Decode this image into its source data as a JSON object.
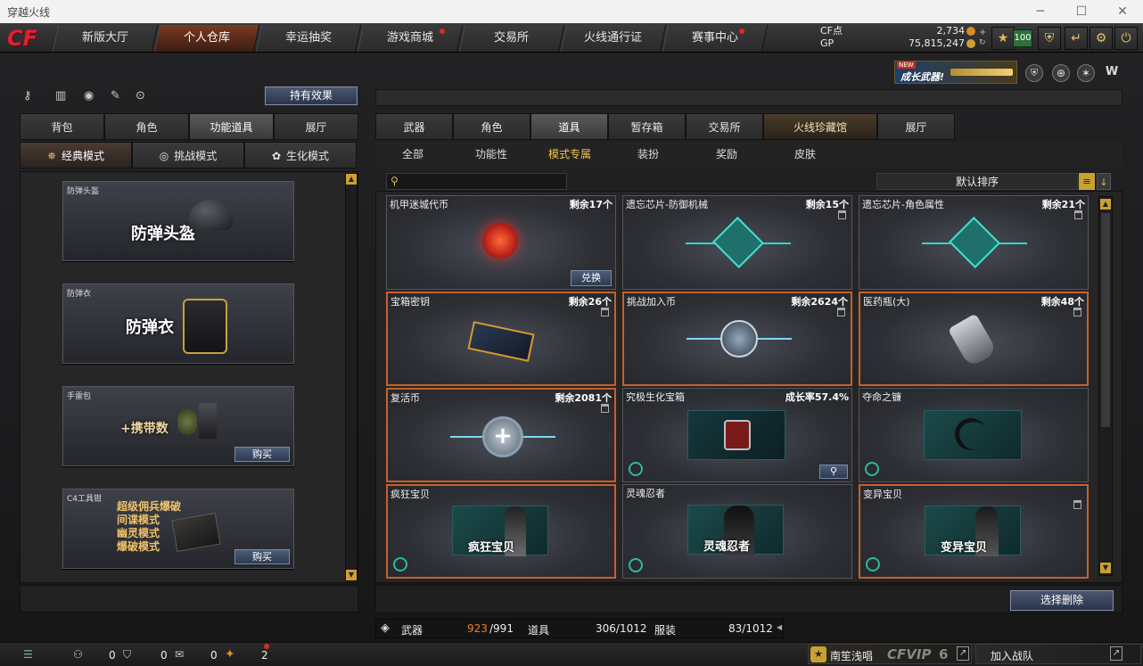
{
  "window": {
    "title": "穿越火线"
  },
  "nav": {
    "tabs": [
      {
        "label": "新版大厅"
      },
      {
        "label": "个人仓库"
      },
      {
        "label": "幸运抽奖"
      },
      {
        "label": "游戏商城"
      },
      {
        "label": "交易所"
      },
      {
        "label": "火线通行证"
      },
      {
        "label": "赛事中心"
      }
    ],
    "active": "个人仓库"
  },
  "currency": {
    "cf_label": "CF点",
    "cf_value": "2,734",
    "gp_label": "GP",
    "gp_value": "75,815,247"
  },
  "level_badge": "100",
  "banner": {
    "new_tag": "NEW",
    "text": "成长武器!"
  },
  "left": {
    "effect_button": "持有效果",
    "tabs": [
      "背包",
      "角色",
      "功能道具",
      "展厅"
    ],
    "modes": [
      "经典模式",
      "挑战模式",
      "生化模式"
    ],
    "cards": [
      {
        "caption": "防弹头盔",
        "title": "防弹头盔"
      },
      {
        "caption": "防弹衣",
        "title": "防弹衣"
      },
      {
        "caption": "手雷包",
        "title": "+携带数",
        "button": "购买"
      },
      {
        "caption": "C4工具钳",
        "lines": [
          "超级佣兵爆破",
          "间谍模式",
          "幽灵模式",
          "爆破模式"
        ],
        "button": "购买"
      }
    ]
  },
  "right": {
    "tabs": [
      "武器",
      "角色",
      "道具",
      "暂存箱",
      "交易所",
      "火线珍藏馆",
      "展厅"
    ],
    "subtabs": [
      "全部",
      "功能性",
      "模式专属",
      "装扮",
      "奖励",
      "皮肤"
    ],
    "active_subtab": "模式专属",
    "sort_label": "默认排序",
    "items": [
      {
        "name": "机甲迷城代币",
        "count": "剩余17个",
        "button": "兑换"
      },
      {
        "name": "遗忘芯片-防御机械",
        "count": "剩余15个"
      },
      {
        "name": "遗忘芯片-角色属性",
        "count": "剩余21个"
      },
      {
        "name": "宝箱密钥",
        "count": "剩余26个"
      },
      {
        "name": "挑战加入币",
        "count": "剩余2624个"
      },
      {
        "name": "医药瓶(大)",
        "count": "剩余48个"
      },
      {
        "name": "复活币",
        "count": "剩余2081个"
      },
      {
        "name": "究极生化宝箱",
        "count": "成长率57.4%"
      },
      {
        "name": "夺命之镰",
        "count": ""
      },
      {
        "name": "疯狂宝贝",
        "count": "",
        "tag": "疯狂宝贝"
      },
      {
        "name": "灵魂忍者",
        "count": "",
        "tag": "灵魂忍者"
      },
      {
        "name": "变异宝贝",
        "count": "",
        "tag": "变异宝贝"
      }
    ],
    "delete_button": "选择删除",
    "stats": {
      "weapon_label": "武器",
      "weapon_used": "923",
      "weapon_total": "/991",
      "item_label": "道具",
      "item_value": "306/1012",
      "outfit_label": "服装",
      "outfit_value": "83/1012"
    }
  },
  "footer": {
    "count1": "0",
    "count2": "0",
    "count3": "0",
    "gift_count": "2",
    "player_name": "南笙浅唱",
    "vip": "CFVIP",
    "vip_level": "6",
    "join_team": "加入战队"
  }
}
